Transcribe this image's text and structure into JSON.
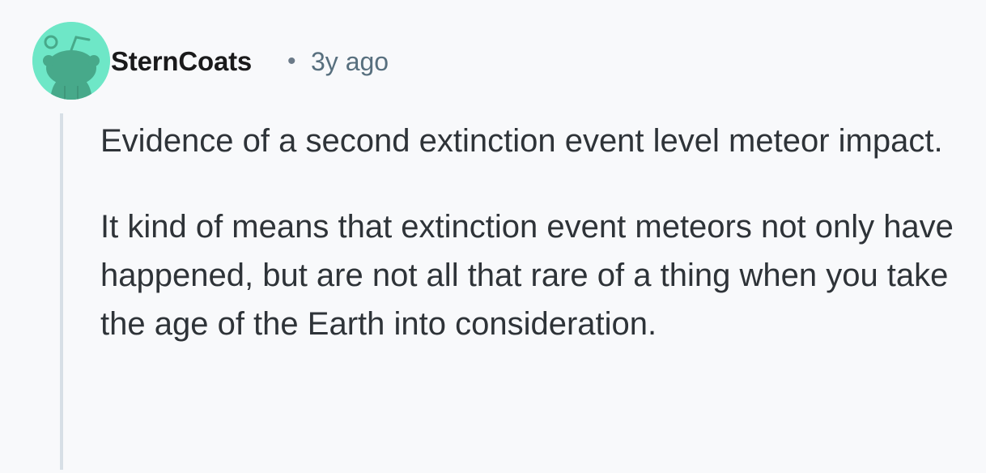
{
  "comment": {
    "author": "SternCoats",
    "separator": "•",
    "timestamp": "3y ago",
    "avatar_icon": "snoo-avatar-icon",
    "avatar_color": "#6ee7c7",
    "paragraphs": [
      "Evidence of a second extinction event level meteor impact.",
      "It kind of means that extinction event meteors not only have happened, but are not all that rare of a thing when you take the age of the Earth into consideration."
    ]
  }
}
